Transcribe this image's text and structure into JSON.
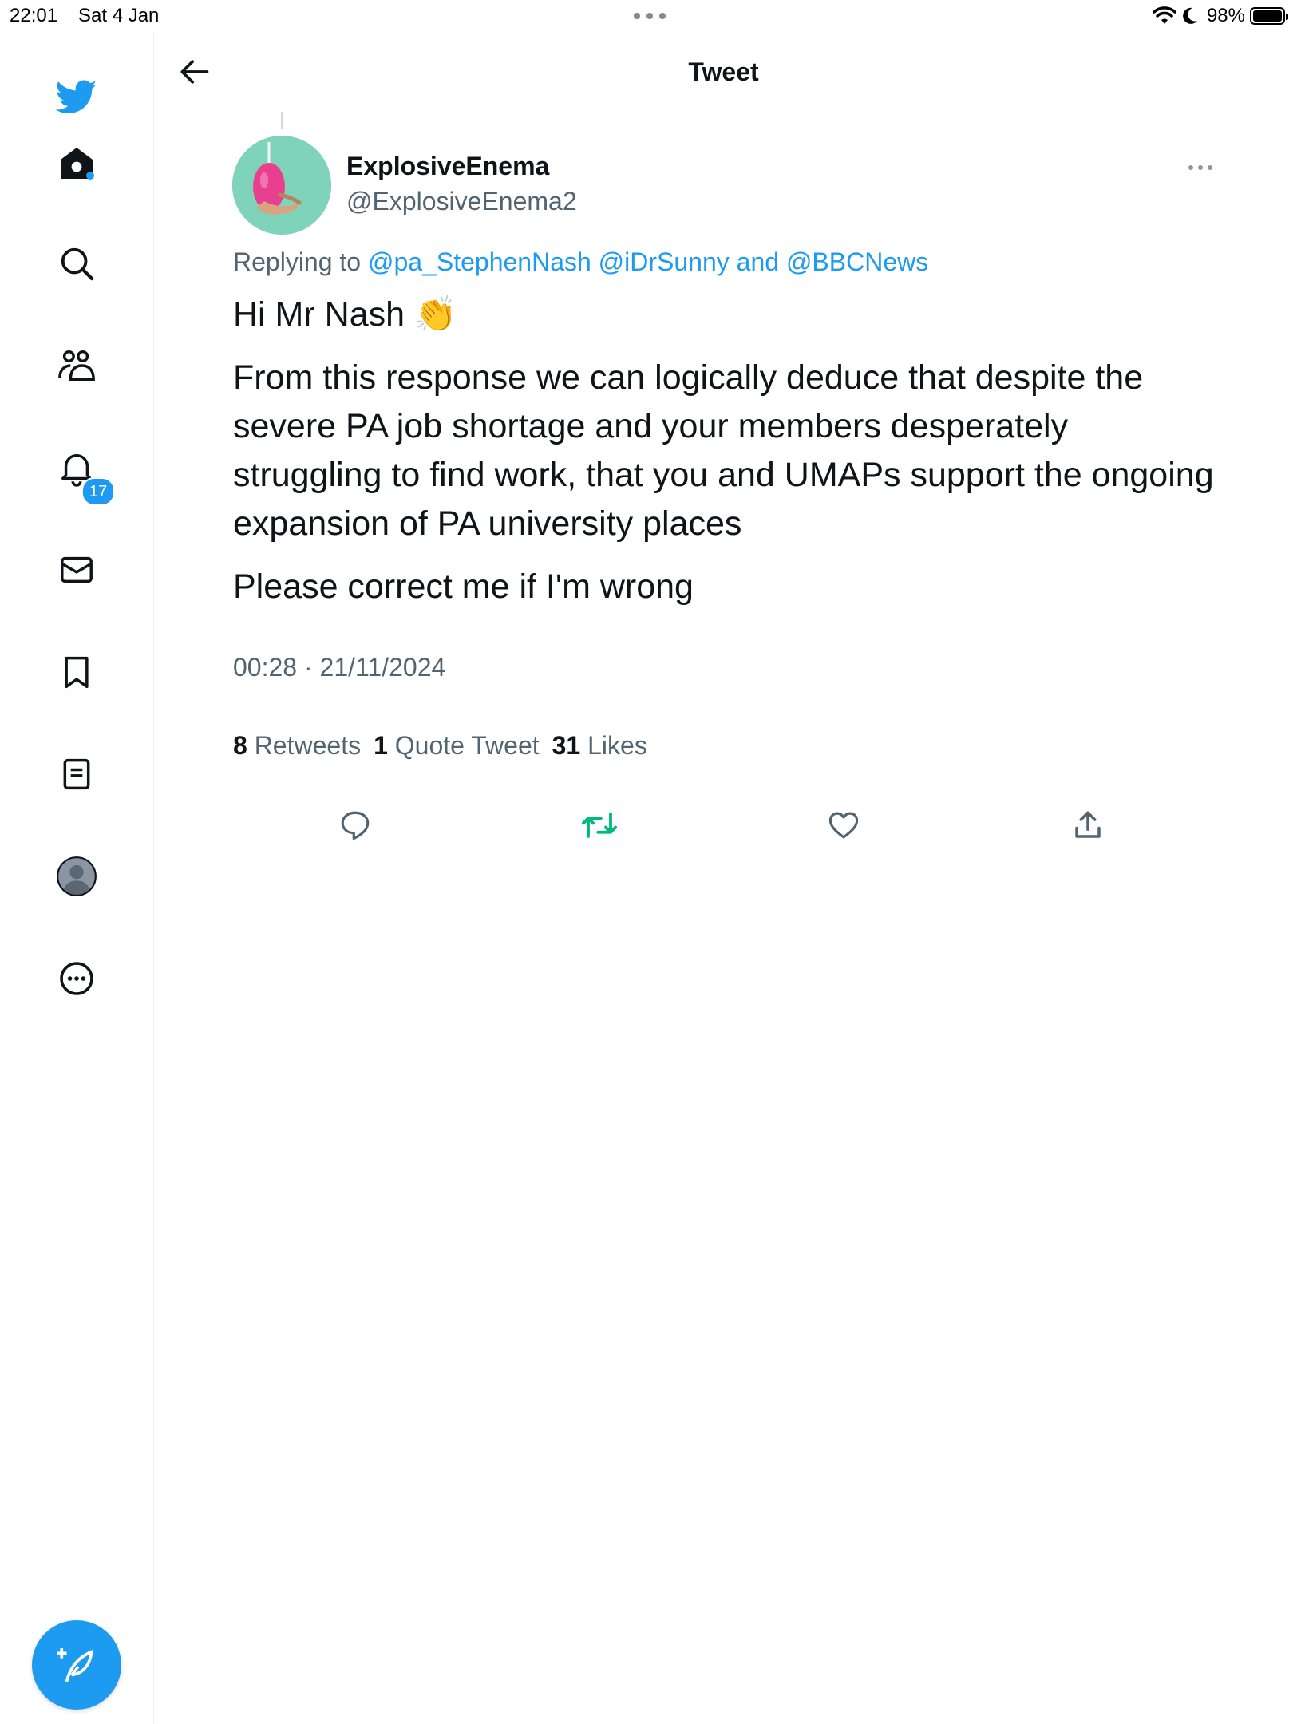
{
  "status_bar": {
    "time": "22:01",
    "date": "Sat 4 Jan",
    "battery": "98%"
  },
  "sidebar": {
    "items": [
      {
        "name": "home",
        "icon": "home-icon"
      },
      {
        "name": "search",
        "icon": "search-icon"
      },
      {
        "name": "communities",
        "icon": "communities-icon"
      },
      {
        "name": "notifications",
        "icon": "bell-icon",
        "badge": "17"
      },
      {
        "name": "messages",
        "icon": "envelope-icon"
      },
      {
        "name": "bookmarks",
        "icon": "bookmark-icon"
      },
      {
        "name": "lists",
        "icon": "list-icon"
      },
      {
        "name": "profile",
        "icon": "avatar-icon"
      },
      {
        "name": "more",
        "icon": "more-circle-icon"
      }
    ]
  },
  "header": {
    "title": "Tweet"
  },
  "tweet": {
    "display_name": "ExplosiveEnema",
    "handle": "@ExplosiveEnema2",
    "replying_prefix": "Replying to",
    "replying_to": [
      "@pa_StephenNash",
      "@iDrSunny",
      "@BBCNews"
    ],
    "replying_and": "and",
    "paragraphs": [
      "Hi Mr Nash 👏",
      "From this response we can logically deduce that despite the severe PA job shortage and your members desperately struggling to find work, that you and UMAPs support the ongoing expansion of PA university places",
      "Please correct me if I'm wrong"
    ],
    "timestamp": "00:28 · 21/11/2024",
    "stats": {
      "retweets_count": "8",
      "retweets_label": "Retweets",
      "quotes_count": "1",
      "quotes_label": "Quote Tweet",
      "likes_count": "31",
      "likes_label": "Likes"
    }
  },
  "colors": {
    "accent": "#1d9bf0",
    "retweet_green": "#00ba7c",
    "secondary_text": "#536471",
    "primary_text": "#0f1419"
  }
}
